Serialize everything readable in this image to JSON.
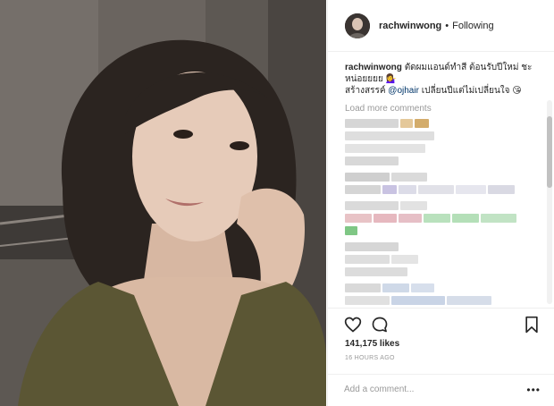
{
  "post": {
    "author": {
      "username": "rachwinwong",
      "separator": "•",
      "follow_status": "Following"
    },
    "caption": {
      "username": "rachwinwong",
      "line1": "ตัดผมแอนด์ทำสี ต้อนรับปีใหม่ ชะหน่อยยยย",
      "line1_emoji": "💁‍♀️",
      "line1_end": "",
      "line2_prefix": "สร้างสรรค์",
      "mention": "@ojhair",
      "line2_suffix": "เปลี่ยนปีแต่ไม่เปลี่ยนใจ",
      "line2_emoji": "😘"
    },
    "load_more_label": "Load more comments",
    "likes_text": "141,175 likes",
    "timestamp": "16 HOURS AGO",
    "comment_placeholder": "Add a comment...",
    "more_options_label": "•••"
  },
  "icons": {
    "like": "heart-icon",
    "comment": "comment-bubble-icon",
    "save": "bookmark-icon"
  },
  "colors": {
    "link": "#003569",
    "muted": "#999999",
    "text": "#262626",
    "divider": "#efefef"
  }
}
